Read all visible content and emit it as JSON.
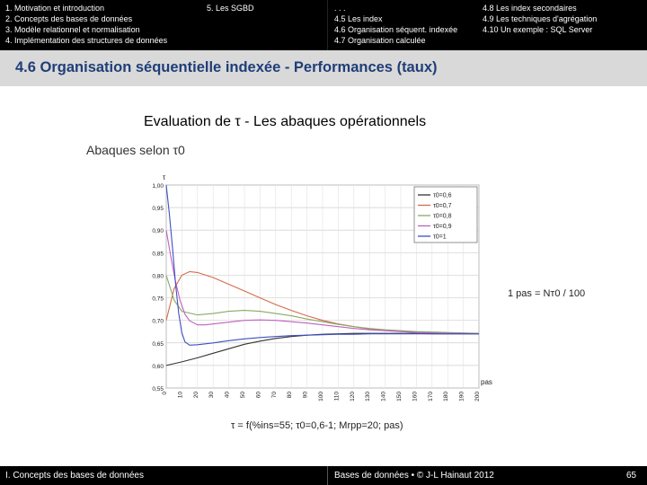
{
  "nav": {
    "col1": [
      "1. Motivation et introduction",
      "2. Concepts des bases de données",
      "3. Modèle relationnel et normalisation",
      "4. Implémentation des structures de données"
    ],
    "col2": [
      "5. Les SGBD"
    ],
    "col3": [
      ". . .",
      "4.5 Les index",
      "4.6 Organisation séquent. indexée",
      "4.7 Organisation calculée"
    ],
    "col4": [
      "4.8 Les index secondaires",
      "4.9 Les techniques d'agrégation",
      "4.10 Un exemple : SQL Server"
    ]
  },
  "slide": {
    "title": "4.6 Organisation séquentielle indexée - Performances (taux)",
    "subtitle": "Evaluation de τ  - Les abaques opérationnels",
    "abaques_label": "Abaques selon τ0",
    "side_note": "1 pas = Nᴛ0 / 100",
    "formula": "τ = f(%ins=55; τ0=0,6-1; Mrpp=20; pas)"
  },
  "footer": {
    "left": "I. Concepts des bases de données",
    "center": "Bases de données • © J-L Hainaut 2012",
    "page": "65"
  },
  "chart_data": {
    "type": "line",
    "title": "",
    "ylabel": "τ",
    "xlabel": "pas",
    "x_ticks": [
      0,
      10,
      20,
      30,
      40,
      50,
      60,
      70,
      80,
      90,
      100,
      110,
      120,
      130,
      140,
      150,
      160,
      170,
      180,
      190,
      200
    ],
    "x_tick_labels": [
      "0",
      "10",
      "20",
      "30",
      "40",
      "50",
      "60",
      "70",
      "80",
      "90",
      "100",
      "110",
      "120",
      "130",
      "140",
      "150",
      "160",
      "170",
      "180",
      "190",
      "200"
    ],
    "y_ticks": [
      0.55,
      0.6,
      0.65,
      0.7,
      0.75,
      0.8,
      0.85,
      0.9,
      0.95,
      1.0
    ],
    "y_tick_labels": [
      "0,55",
      "0,60",
      "0,65",
      "0,70",
      "0,75",
      "0,80",
      "0,85",
      "0,90",
      "0,95",
      "1,00"
    ],
    "xlim": [
      0,
      200
    ],
    "ylim": [
      0.55,
      1.0
    ],
    "grid": true,
    "legend_position": "top-right",
    "colors": [
      "#333333",
      "#d46a4a",
      "#88aa66",
      "#c060c0",
      "#3f4fbf"
    ],
    "series": [
      {
        "name": "τ0=0,6",
        "x": [
          0,
          10,
          20,
          30,
          40,
          50,
          60,
          70,
          80,
          90,
          100,
          110,
          120,
          130,
          140,
          150,
          160,
          170,
          180,
          190,
          200
        ],
        "y": [
          0.6,
          0.608,
          0.617,
          0.627,
          0.637,
          0.647,
          0.654,
          0.66,
          0.664,
          0.667,
          0.669,
          0.67,
          0.671,
          0.671,
          0.671,
          0.671,
          0.671,
          0.67,
          0.67,
          0.67,
          0.67
        ]
      },
      {
        "name": "τ0=0,7",
        "x": [
          0,
          5,
          10,
          15,
          20,
          30,
          40,
          50,
          60,
          70,
          80,
          90,
          100,
          110,
          120,
          130,
          140,
          150,
          160,
          170,
          180,
          190,
          200
        ],
        "y": [
          0.7,
          0.77,
          0.8,
          0.808,
          0.806,
          0.795,
          0.78,
          0.765,
          0.75,
          0.735,
          0.722,
          0.71,
          0.7,
          0.692,
          0.686,
          0.681,
          0.678,
          0.676,
          0.674,
          0.673,
          0.672,
          0.671,
          0.671
        ]
      },
      {
        "name": "τ0=0,8",
        "x": [
          0,
          5,
          10,
          20,
          30,
          40,
          50,
          60,
          70,
          80,
          90,
          100,
          110,
          120,
          130,
          140,
          150,
          160,
          170,
          180,
          190,
          200
        ],
        "y": [
          0.8,
          0.745,
          0.72,
          0.712,
          0.715,
          0.72,
          0.722,
          0.72,
          0.715,
          0.71,
          0.703,
          0.697,
          0.691,
          0.686,
          0.682,
          0.679,
          0.677,
          0.675,
          0.674,
          0.673,
          0.672,
          0.671
        ]
      },
      {
        "name": "τ0=0,9",
        "x": [
          0,
          3,
          6,
          9,
          12,
          15,
          20,
          25,
          30,
          40,
          50,
          60,
          70,
          80,
          90,
          100,
          110,
          120,
          130,
          140,
          150,
          160,
          170,
          180,
          190,
          200
        ],
        "y": [
          0.9,
          0.84,
          0.785,
          0.742,
          0.713,
          0.699,
          0.69,
          0.69,
          0.692,
          0.696,
          0.7,
          0.701,
          0.7,
          0.697,
          0.694,
          0.69,
          0.686,
          0.682,
          0.679,
          0.677,
          0.675,
          0.673,
          0.672,
          0.671,
          0.671,
          0.67
        ]
      },
      {
        "name": "τ0=1",
        "x": [
          0,
          2,
          4,
          6,
          8,
          10,
          12,
          15,
          20,
          25,
          30,
          40,
          50,
          60,
          70,
          80,
          90,
          100,
          110,
          120,
          130,
          140,
          150,
          160,
          170,
          180,
          190,
          200
        ],
        "y": [
          1.0,
          0.935,
          0.86,
          0.78,
          0.715,
          0.672,
          0.652,
          0.645,
          0.646,
          0.648,
          0.65,
          0.655,
          0.659,
          0.662,
          0.664,
          0.666,
          0.667,
          0.668,
          0.669,
          0.669,
          0.67,
          0.67,
          0.67,
          0.67,
          0.67,
          0.67,
          0.67,
          0.67
        ]
      }
    ]
  }
}
